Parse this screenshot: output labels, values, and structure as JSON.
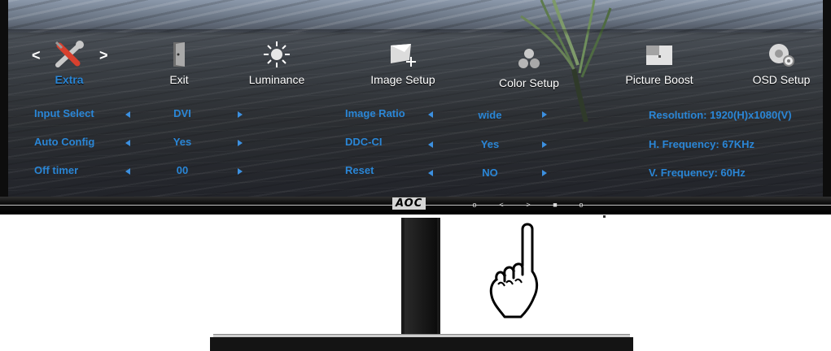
{
  "brand": {
    "logo_text": "AOC"
  },
  "menu": {
    "items": [
      {
        "label": "Extra",
        "icon": "wrench-screwdriver-icon",
        "active": true
      },
      {
        "label": "Exit",
        "icon": "door-exit-icon"
      },
      {
        "label": "Luminance",
        "icon": "sun-brightness-icon"
      },
      {
        "label": "Image Setup",
        "icon": "image-setup-icon"
      },
      {
        "label": "Color Setup",
        "icon": "color-balls-icon"
      },
      {
        "label": "Picture Boost",
        "icon": "picture-boost-icon"
      },
      {
        "label": "OSD Setup",
        "icon": "osd-gear-icon"
      }
    ],
    "nav_prev": "<",
    "nav_next": ">"
  },
  "settings_left": [
    {
      "label": "Input Select",
      "value": "DVI"
    },
    {
      "label": "Auto Config",
      "value": "Yes"
    },
    {
      "label": "Off timer",
      "value": "00"
    }
  ],
  "settings_middle": [
    {
      "label": "Image Ratio",
      "value": "wide"
    },
    {
      "label": "DDC-CI",
      "value": "Yes"
    },
    {
      "label": "Reset",
      "value": "NO"
    }
  ],
  "info": [
    "Resolution:  1920(H)x1080(V)",
    "H. Frequency:  67KHz",
    "V. Frequency:  60Hz"
  ],
  "bezel_buttons": [
    "o",
    "<",
    ">",
    "■",
    "o"
  ],
  "colors": {
    "accent": "#2a86d6",
    "label_white": "#ffffff",
    "bezel": "#0d0d0d"
  }
}
